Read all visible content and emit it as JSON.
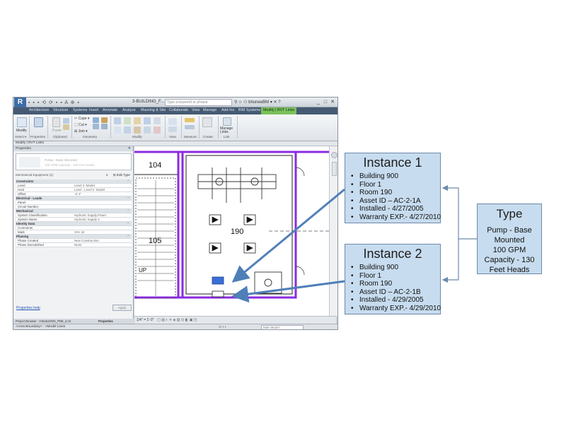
{
  "window": {
    "doc_title": "3-BUILDING_F...",
    "search_placeholder": "Type a keyword or phrase",
    "user": "bhuneeBM",
    "controls": [
      "_",
      "□",
      "✕"
    ]
  },
  "ribbon": {
    "tabs": [
      "Architecture",
      "Structure",
      "Systems",
      "Insert",
      "Annotate",
      "Analyze",
      "Massing & Site",
      "Collaborate",
      "View",
      "Manage",
      "Add-Ins",
      "BIM Systems",
      "Modify | RVT Links"
    ],
    "active_tab": "Modify | RVT Links",
    "buttons": {
      "modify": "Modify",
      "paste": "Paste",
      "cope": "Cope",
      "cut": "Cut",
      "join": "Join",
      "manage_links": "Manage Links"
    },
    "groups": [
      "Select ▾",
      "Properties",
      "Clipboard",
      "Geometry",
      "Modify",
      "View",
      "Measure",
      "Create",
      "Link"
    ]
  },
  "context_bar": {
    "label": "Modify | RVT Links"
  },
  "properties": {
    "header": "Properties",
    "type_name": "Pump - Base Mounted",
    "type_sub": "100 GPM Capacity - 130 Feet Heads",
    "selector": "Mechanical Equipment (1)",
    "edit_type": "Edit Type",
    "rows": [
      {
        "k": "Constraints",
        "v": "⌃",
        "section": true
      },
      {
        "k": "Level",
        "v": "Level 2 -Model",
        "section": false
      },
      {
        "k": "Host",
        "v": "Level : Level 2 -Model",
        "section": false
      },
      {
        "k": "Offset",
        "v": "-0'  2\"",
        "section": false
      },
      {
        "k": "Electrical - Loads",
        "v": "⌃",
        "section": true
      },
      {
        "k": "Panel",
        "v": "",
        "section": false
      },
      {
        "k": "Circuit Number",
        "v": "",
        "section": false
      },
      {
        "k": "Mechanical",
        "v": "⌃",
        "section": true
      },
      {
        "k": "System Classification",
        "v": "Hydronic Supply,Power",
        "section": false
      },
      {
        "k": "System Name",
        "v": "Hydronic Supply 4",
        "section": false
      },
      {
        "k": "Identity Data",
        "v": "⌃",
        "section": true
      },
      {
        "k": "Comments",
        "v": "",
        "section": false
      },
      {
        "k": "Mark",
        "v": "VAV 42",
        "section": false
      },
      {
        "k": "Phasing",
        "v": "⌃",
        "section": true
      },
      {
        "k": "Phase Created",
        "v": "New Construction",
        "section": false
      },
      {
        "k": "Phase Demolished",
        "v": "None",
        "section": false
      }
    ],
    "help_link": "Properties help",
    "apply": "Apply"
  },
  "browser_tabs": [
    "Project Browser - 3-BUILDING_PDE_3.rvt",
    "Properties"
  ],
  "canvas": {
    "room_104": "104",
    "room_190": "190",
    "room_105": "105",
    "up": "UP"
  },
  "view_control": {
    "scale": "1/4\" = 1'-0\""
  },
  "status": {
    "text": "<Area Boundary> : <Model Lines",
    "model": "Main Model"
  },
  "callouts": {
    "instance1": {
      "title": "Instance 1",
      "items": [
        "Building 900",
        "Floor 1",
        "Room 190",
        "Asset ID – AC-2-1A",
        "Installed - 4/27/2005",
        "Warranty EXP.-  4/27/2010"
      ]
    },
    "instance2": {
      "title": "Instance 2",
      "items": [
        "Building 900",
        "Floor 1",
        "Room 190",
        "Asset ID – AC-2-1B",
        "Installed - 4/29/2005",
        "Warranty EXP.-  4/29/2010"
      ]
    },
    "type": {
      "title": "Type",
      "lines": [
        "Pump - Base",
        "Mounted",
        "100 GPM",
        "Capacity - 130",
        "Feet Heads"
      ]
    }
  },
  "colors": {
    "wall_purple": "#8a2be2",
    "callout_fill": "#c7dcef",
    "arrow_blue": "#4f7fb8",
    "selected_blue": "#3a6fd8",
    "active_tab_green": "#7cc15c"
  }
}
